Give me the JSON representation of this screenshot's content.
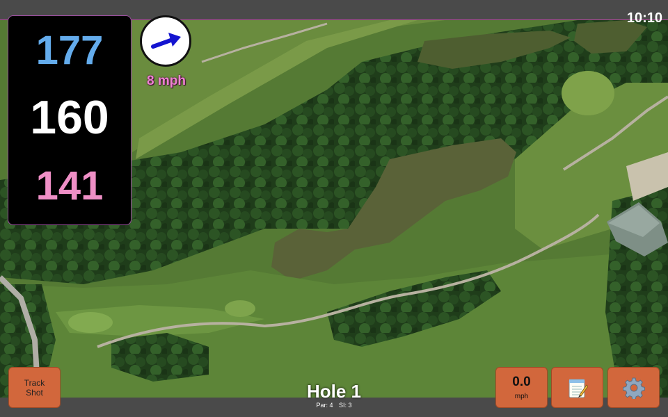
{
  "status_bar": {
    "time": "10:10"
  },
  "yardages": {
    "back": "177",
    "middle": "160",
    "front": "141"
  },
  "wind": {
    "speed_label": "8 mph",
    "direction_icon": "wind-arrow-icon"
  },
  "buttons": {
    "track_shot_line1": "Track",
    "track_shot_line2": "Shot",
    "speed_value": "0.0",
    "speed_unit": "mph",
    "notes_icon": "notepad-icon",
    "settings_icon": "gear-icon"
  },
  "hole": {
    "title": "Hole 1",
    "par": "Par: 4",
    "si": "SI: 3"
  },
  "colors": {
    "back": "#64acec",
    "middle": "#ffffff",
    "front": "#ef8fc6",
    "button": "#d2673c",
    "wind_text": "#ee82d2"
  }
}
